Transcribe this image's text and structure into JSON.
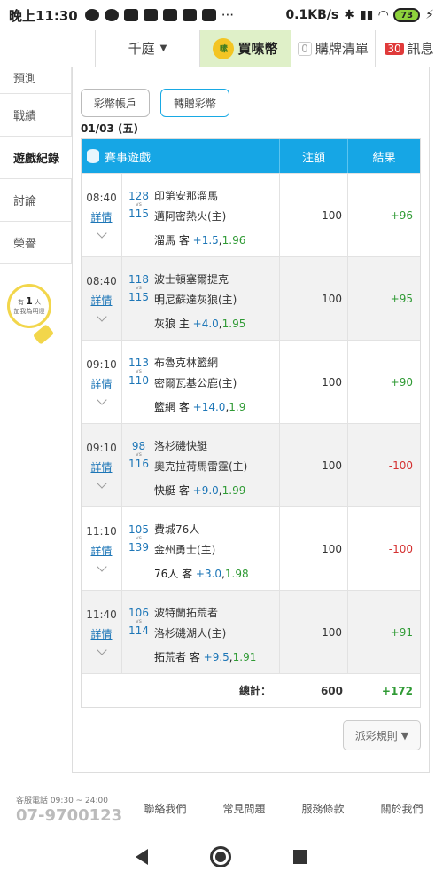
{
  "statusbar": {
    "time": "晚上11:30",
    "speed": "0.1KB/s",
    "battery": "73"
  },
  "topbar": {
    "user": "千庭",
    "buy": "買嗉幣",
    "coin_text": "嗉",
    "cart_count": "0",
    "cart": "購牌清單",
    "msg_count": "30",
    "msg": "訊息"
  },
  "sidebar": {
    "items": [
      "預測",
      "戰績",
      "遊戲紀錄",
      "討論",
      "榮譽"
    ],
    "bulb_prefix": "有",
    "bulb_count": "1",
    "bulb_unit": "人",
    "bulb_text": "加我為明燈"
  },
  "tabs": [
    "彩幣帳戶",
    "轉贈彩幣"
  ],
  "date": "01/03 (五)",
  "table": {
    "headers": {
      "game": "賽事遊戲",
      "bet": "注額",
      "result": "結果"
    },
    "detail_label": "詳情",
    "vs": "vs",
    "rows": [
      {
        "time": "08:40",
        "s1": "128",
        "s2": "115",
        "team1": "印第安那溜馬",
        "team2": "邁阿密熱火(主)",
        "pick": "溜馬 客",
        "odd": "+1.5",
        "rate": "1.96",
        "bet": "100",
        "result": "+96",
        "win": true
      },
      {
        "time": "08:40",
        "s1": "118",
        "s2": "115",
        "team1": "波士頓塞爾提克",
        "team2": "明尼蘇達灰狼(主)",
        "pick": "灰狼 主",
        "odd": "+4.0",
        "rate": "1.95",
        "bet": "100",
        "result": "+95",
        "win": true
      },
      {
        "time": "09:10",
        "s1": "113",
        "s2": "110",
        "team1": "布魯克林籃網",
        "team2": "密爾瓦基公鹿(主)",
        "pick": "籃網 客",
        "odd": "+14.0",
        "rate": "1.9",
        "bet": "100",
        "result": "+90",
        "win": true
      },
      {
        "time": "09:10",
        "s1": "98",
        "s2": "116",
        "team1": "洛杉磯快艇",
        "team2": "奧克拉荷馬雷霆(主)",
        "pick": "快艇 客",
        "odd": "+9.0",
        "rate": "1.99",
        "bet": "100",
        "result": "-100",
        "win": false
      },
      {
        "time": "11:10",
        "s1": "105",
        "s2": "139",
        "team1": "費城76人",
        "team2": "金州勇士(主)",
        "pick": "76人 客",
        "odd": "+3.0",
        "rate": "1.98",
        "bet": "100",
        "result": "-100",
        "win": false
      },
      {
        "time": "11:40",
        "s1": "106",
        "s2": "114",
        "team1": "波特蘭拓荒者",
        "team2": "洛杉磯湖人(主)",
        "pick": "拓荒者 客",
        "odd": "+9.5",
        "rate": "1.91",
        "bet": "100",
        "result": "+91",
        "win": true
      }
    ],
    "total_label": "總計：",
    "total_bet": "600",
    "total_result": "+172"
  },
  "rules_button": "派彩規則",
  "footer": {
    "hotline": "客服電話 09:30 ~ 24:00",
    "phone": "07-9700123",
    "links": [
      "聯絡我們",
      "常見問題",
      "服務條款",
      "關於我們"
    ]
  },
  "colors": {
    "header_blue": "#16a6e5",
    "win": "#2f9a34",
    "loss": "#d43030",
    "buy_bg": "#dff0c8"
  }
}
